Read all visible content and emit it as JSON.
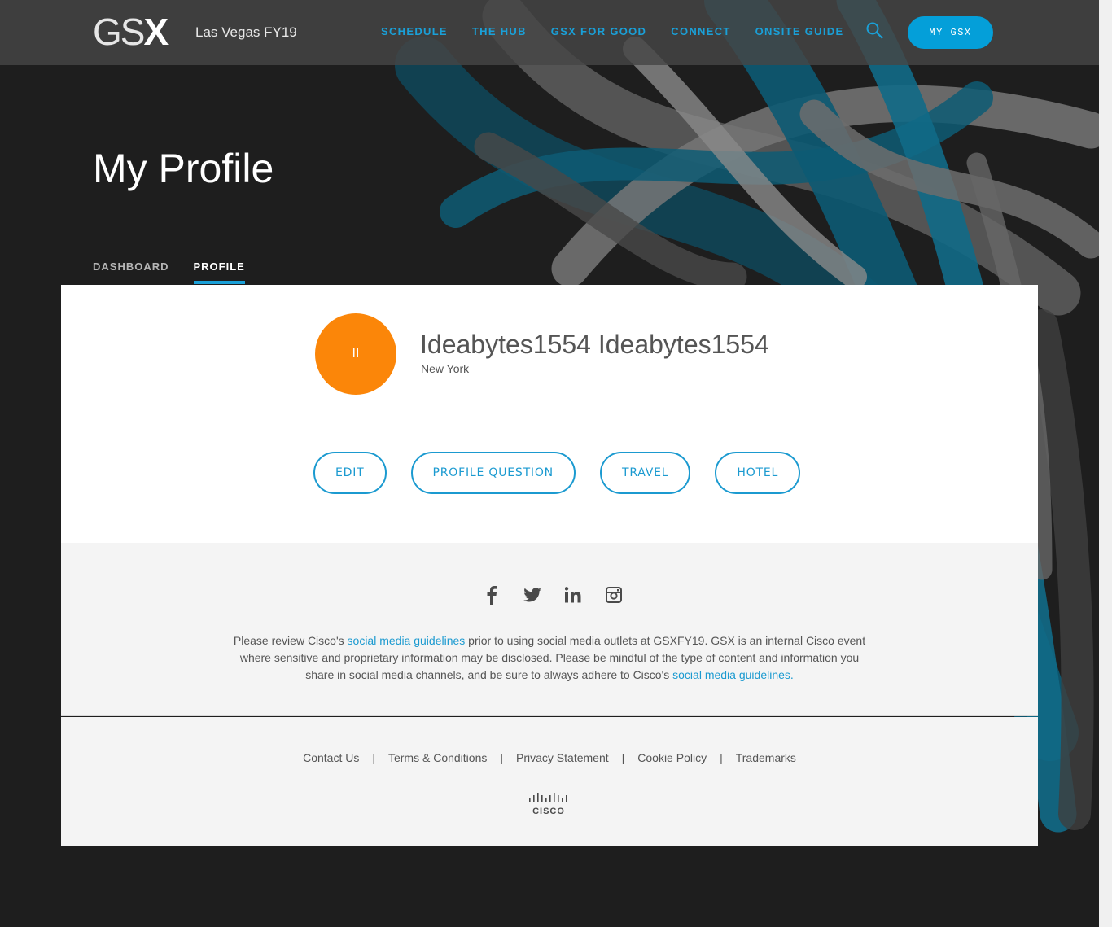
{
  "header": {
    "logo_text": "GS",
    "logo_x": "X",
    "event_name": "Las Vegas FY19",
    "nav": [
      "SCHEDULE",
      "THE HUB",
      "GSX FOR GOOD",
      "CONNECT",
      "ONSITE GUIDE"
    ],
    "search_icon": "search-icon",
    "my_gsx_label": "MY GSX"
  },
  "page": {
    "title": "My Profile",
    "tabs": [
      {
        "label": "DASHBOARD",
        "active": false
      },
      {
        "label": "PROFILE",
        "active": true
      }
    ]
  },
  "profile": {
    "avatar_glyph": "II",
    "avatar_color": "#fb8609",
    "name": "Ideabytes1554 Ideabytes1554",
    "location": "New York",
    "actions": [
      "EDIT",
      "PROFILE QUESTION",
      "TRAVEL",
      "HOTEL"
    ]
  },
  "social": {
    "icons": [
      "facebook-icon",
      "twitter-icon",
      "linkedin-icon",
      "instagram-icon"
    ],
    "disclaimer_pre": "Please review Cisco's ",
    "link1": "social media guidelines",
    "disclaimer_mid": " prior to using social media outlets at GSXFY19. GSX is an internal Cisco event where sensitive and proprietary information may be disclosed. Please be mindful of the type of content and information you share in social media channels, and be sure to always adhere to Cisco's ",
    "link2": "social media guidelines."
  },
  "footer": {
    "links": [
      "Contact Us",
      "Terms & Conditions",
      "Privacy Statement",
      "Cookie Policy",
      "Trademarks"
    ],
    "separator": "|",
    "brand": "CISCO"
  },
  "colors": {
    "accent": "#049fd9",
    "nav_link": "#1aa0d8",
    "background": "#1e1e1e"
  }
}
